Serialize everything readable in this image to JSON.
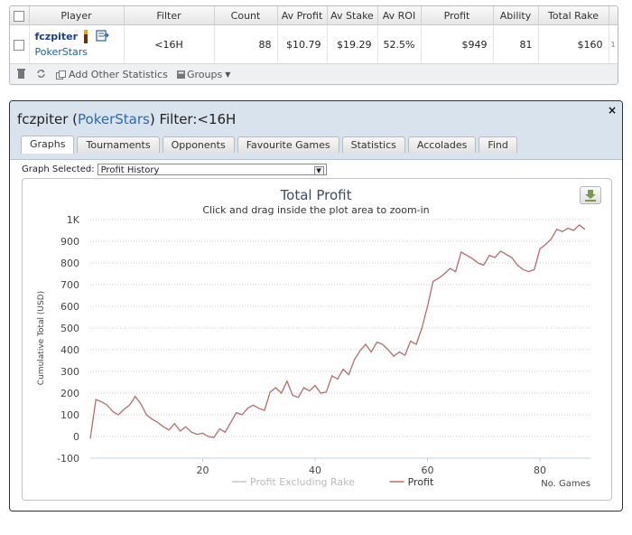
{
  "stats_table": {
    "headers": [
      "Player",
      "Filter",
      "Count",
      "Av Profit",
      "Av Stake",
      "Av ROI",
      "Profit",
      "Ability",
      "Total Rake"
    ],
    "row": {
      "player_name": "fczpiter",
      "site": "PokerStars",
      "filter": "<16H",
      "count": "88",
      "av_profit": "$10.79",
      "av_stake": "$19.29",
      "av_roi": "52.5%",
      "profit": "$949",
      "ability": "81",
      "total_rake": "$160"
    },
    "overflow_mark": "1",
    "toolbar": {
      "add_stats": "Add Other Statistics",
      "groups": "Groups"
    },
    "icons": [
      "trash-icon",
      "refresh-icon",
      "copy-icon",
      "groups-icon",
      "personal-best-icon",
      "notes-icon"
    ]
  },
  "panel": {
    "title_name": "fczpiter",
    "title_open": "(",
    "title_site": "PokerStars",
    "title_rest": ") Filter:<16H",
    "close": "×",
    "tabs": [
      "Graphs",
      "Tournaments",
      "Opponents",
      "Favourite Games",
      "Statistics",
      "Accolades",
      "Find"
    ],
    "active_tab": "Graphs",
    "graph_selected_label": "Graph Selected:",
    "graph_selected_value": "Profit History"
  },
  "chart_data": {
    "type": "line",
    "title": "Total Profit",
    "subtitle": "Click and drag inside the plot area to zoom-in",
    "ylabel": "Cumulative Total (USD)",
    "xlabel": "No. Games",
    "ylim": [
      -100,
      1000
    ],
    "xlim": [
      0,
      89
    ],
    "y_ticks": [
      {
        "value": 1000,
        "label": "1K"
      },
      {
        "value": 900,
        "label": "900"
      },
      {
        "value": 800,
        "label": "800"
      },
      {
        "value": 700,
        "label": "700"
      },
      {
        "value": 600,
        "label": "600"
      },
      {
        "value": 500,
        "label": "500"
      },
      {
        "value": 400,
        "label": "400"
      },
      {
        "value": 300,
        "label": "300"
      },
      {
        "value": 200,
        "label": "200"
      },
      {
        "value": 100,
        "label": "100"
      },
      {
        "value": 0,
        "label": "0"
      },
      {
        "value": -100,
        "label": "-100"
      }
    ],
    "x_ticks": [
      {
        "value": 20,
        "label": "20"
      },
      {
        "value": 40,
        "label": "40"
      },
      {
        "value": 60,
        "label": "60"
      },
      {
        "value": 80,
        "label": "80"
      }
    ],
    "grid": true,
    "legend_position": "bottom",
    "series": [
      {
        "name": "Profit Excluding Rake",
        "color": "#c8c8c8",
        "values": []
      },
      {
        "name": "Profit",
        "color": "#b86b6b",
        "values": [
          [
            0,
            -10
          ],
          [
            1,
            170
          ],
          [
            2,
            160
          ],
          [
            3,
            145
          ],
          [
            4,
            115
          ],
          [
            5,
            100
          ],
          [
            6,
            125
          ],
          [
            7,
            145
          ],
          [
            8,
            185
          ],
          [
            9,
            150
          ],
          [
            10,
            100
          ],
          [
            11,
            80
          ],
          [
            12,
            65
          ],
          [
            13,
            45
          ],
          [
            14,
            30
          ],
          [
            15,
            60
          ],
          [
            16,
            25
          ],
          [
            17,
            45
          ],
          [
            18,
            20
          ],
          [
            19,
            10
          ],
          [
            20,
            15
          ],
          [
            21,
            0
          ],
          [
            22,
            -5
          ],
          [
            23,
            35
          ],
          [
            24,
            20
          ],
          [
            25,
            65
          ],
          [
            26,
            110
          ],
          [
            27,
            100
          ],
          [
            28,
            130
          ],
          [
            29,
            145
          ],
          [
            30,
            130
          ],
          [
            31,
            120
          ],
          [
            32,
            205
          ],
          [
            33,
            225
          ],
          [
            34,
            200
          ],
          [
            35,
            255
          ],
          [
            36,
            190
          ],
          [
            37,
            180
          ],
          [
            38,
            225
          ],
          [
            39,
            210
          ],
          [
            40,
            235
          ],
          [
            41,
            200
          ],
          [
            42,
            205
          ],
          [
            43,
            280
          ],
          [
            44,
            265
          ],
          [
            45,
            310
          ],
          [
            46,
            285
          ],
          [
            47,
            355
          ],
          [
            48,
            395
          ],
          [
            49,
            425
          ],
          [
            50,
            390
          ],
          [
            51,
            435
          ],
          [
            52,
            425
          ],
          [
            53,
            400
          ],
          [
            54,
            370
          ],
          [
            55,
            390
          ],
          [
            56,
            375
          ],
          [
            57,
            440
          ],
          [
            58,
            425
          ],
          [
            59,
            500
          ],
          [
            60,
            600
          ],
          [
            61,
            715
          ],
          [
            62,
            730
          ],
          [
            63,
            750
          ],
          [
            64,
            775
          ],
          [
            65,
            760
          ],
          [
            66,
            850
          ],
          [
            67,
            835
          ],
          [
            68,
            820
          ],
          [
            69,
            800
          ],
          [
            70,
            790
          ],
          [
            71,
            835
          ],
          [
            72,
            825
          ],
          [
            73,
            855
          ],
          [
            74,
            840
          ],
          [
            75,
            825
          ],
          [
            76,
            790
          ],
          [
            77,
            770
          ],
          [
            78,
            760
          ],
          [
            79,
            770
          ],
          [
            80,
            865
          ],
          [
            81,
            885
          ],
          [
            82,
            910
          ],
          [
            83,
            955
          ],
          [
            84,
            945
          ],
          [
            85,
            960
          ],
          [
            86,
            950
          ],
          [
            87,
            975
          ],
          [
            88,
            955
          ]
        ]
      }
    ]
  },
  "colors": {
    "panel_header": "#d9e3ee",
    "link_blue": "#2a6ab4",
    "series_profit": "#b86b6b",
    "series_excl_rake": "#c8c8c8",
    "grid": "#c8c8c8"
  }
}
